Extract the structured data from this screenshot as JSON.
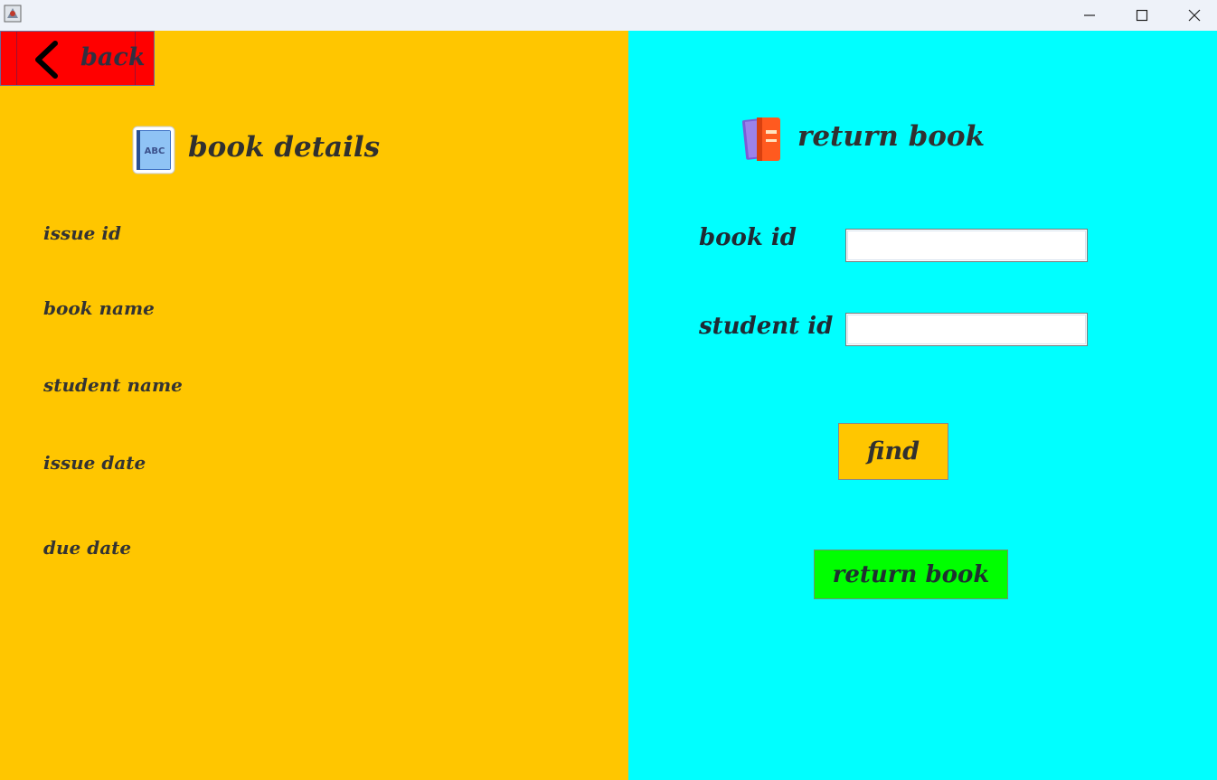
{
  "window": {
    "title": "",
    "controls": {
      "minimize_icon": "minimize-icon",
      "maximize_icon": "maximize-icon",
      "close_icon": "close-icon"
    }
  },
  "left_panel": {
    "background": "#ffc600",
    "back_button": {
      "label": "back",
      "icon": "chevron-left-icon",
      "color": "#ff0000"
    },
    "heading": {
      "label": "book details",
      "icon": "book-abc-icon"
    },
    "fields": [
      {
        "label": "issue id"
      },
      {
        "label": "book name"
      },
      {
        "label": "student name"
      },
      {
        "label": "issue date"
      },
      {
        "label": "due date"
      }
    ]
  },
  "right_panel": {
    "background": "#00ffff",
    "heading": {
      "label": "return book",
      "icon": "books-icon"
    },
    "book_id": {
      "label": "book id",
      "value": ""
    },
    "student_id": {
      "label": "student id",
      "value": ""
    },
    "find_button": {
      "label": "find",
      "color": "#ffc600"
    },
    "return_button": {
      "label": "return book",
      "color": "#00ff00"
    }
  }
}
